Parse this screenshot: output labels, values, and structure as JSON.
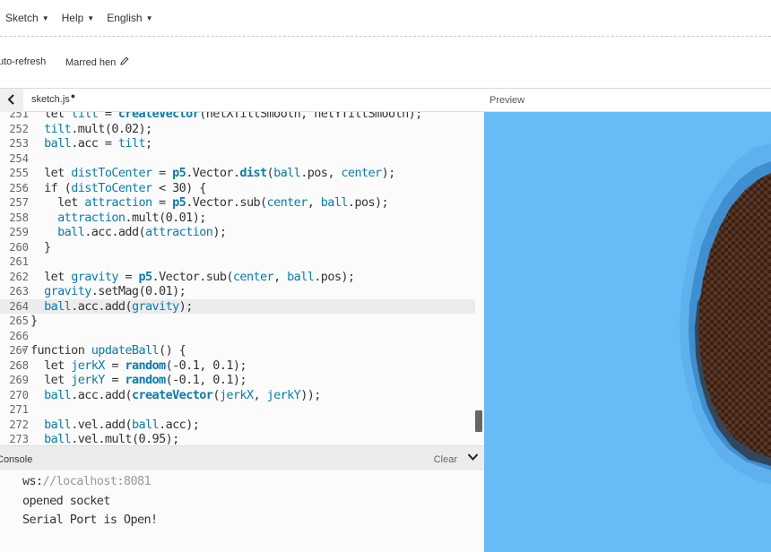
{
  "menu": {
    "items": [
      {
        "label": "Sketch"
      },
      {
        "label": "Help"
      },
      {
        "label": "English"
      }
    ]
  },
  "toolbar": {
    "auto_refresh_label": "uto-refresh",
    "sketch_name": "Marred hen"
  },
  "editor": {
    "tab_label": "sketch.js",
    "unsaved_marker": "●",
    "preview_label": "Preview",
    "active_line": "264",
    "lines": [
      {
        "n": "251",
        "t": "  let tilt = createVector(netXTiltSmooth, netYTiltSmooth);"
      },
      {
        "n": "252",
        "t": "  tilt.mult(0.02);"
      },
      {
        "n": "253",
        "t": "  ball.acc = tilt;"
      },
      {
        "n": "254",
        "t": ""
      },
      {
        "n": "255",
        "t": "  let distToCenter = p5.Vector.dist(ball.pos, center);"
      },
      {
        "n": "256",
        "t": "  if (distToCenter < 30) {"
      },
      {
        "n": "257",
        "t": "    let attraction = p5.Vector.sub(center, ball.pos);"
      },
      {
        "n": "258",
        "t": "    attraction.mult(0.01);"
      },
      {
        "n": "259",
        "t": "    ball.acc.add(attraction);"
      },
      {
        "n": "260",
        "t": "  }"
      },
      {
        "n": "261",
        "t": ""
      },
      {
        "n": "262",
        "t": "  let gravity = p5.Vector.sub(center, ball.pos);"
      },
      {
        "n": "263",
        "t": "  gravity.setMag(0.01);"
      },
      {
        "n": "264",
        "t": "  ball.acc.add(gravity);"
      },
      {
        "n": "265",
        "t": "}"
      },
      {
        "n": "266",
        "t": ""
      },
      {
        "n": "267",
        "t": "function updateBall() {"
      },
      {
        "n": "268",
        "t": "  let jerkX = random(-0.1, 0.1);"
      },
      {
        "n": "269",
        "t": "  let jerkY = random(-0.1, 0.1);"
      },
      {
        "n": "270",
        "t": "  ball.acc.add(createVector(jerkX, jerkY));"
      },
      {
        "n": "271",
        "t": ""
      },
      {
        "n": "272",
        "t": "  ball.vel.add(ball.acc);"
      },
      {
        "n": "273",
        "t": "  ball.vel.mult(0.95);"
      }
    ]
  },
  "console": {
    "title": "Console",
    "clear_label": "Clear",
    "messages": [
      {
        "prefix": "ws:",
        "rest": "//localhost:8081"
      },
      {
        "prefix": "opened socket",
        "rest": ""
      },
      {
        "prefix": "Serial Port is Open!",
        "rest": ""
      }
    ]
  },
  "icons": {
    "collapse": "chevron-left-icon",
    "pencil": "pencil-icon",
    "console_toggle": "chevron-down-icon"
  },
  "colors": {
    "preview_bg": "#67bcf5",
    "ball_dark": "#3e2418",
    "ball_edge": "#3f8ed0",
    "syntax_accent": "#0b7ca9"
  }
}
